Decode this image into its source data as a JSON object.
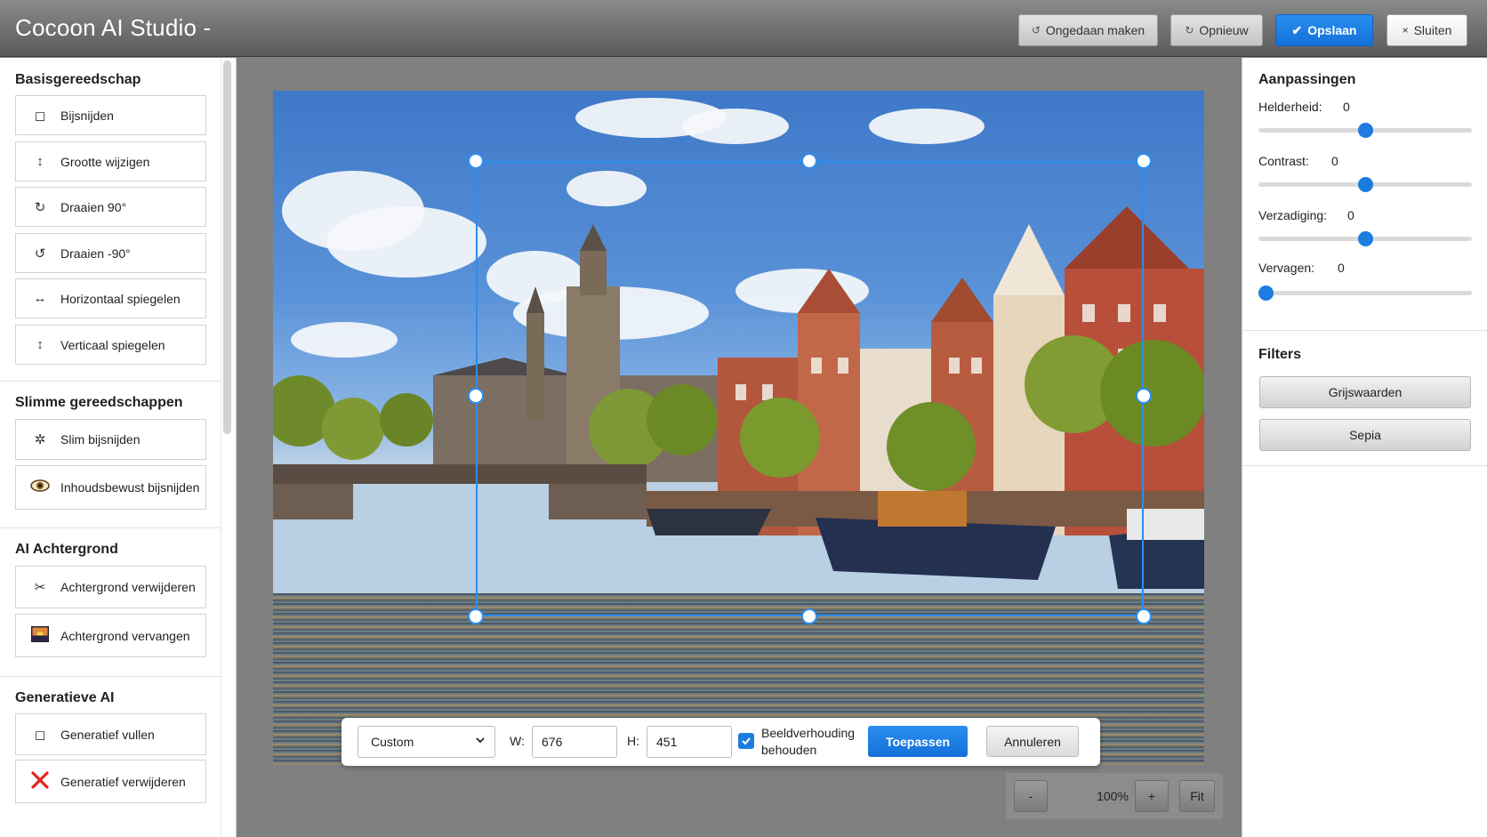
{
  "header": {
    "title": "Cocoon AI Studio -",
    "undo_label": "Ongedaan maken",
    "redo_label": "Opnieuw",
    "save_label": "Opslaan",
    "close_label": "Sluiten"
  },
  "sidebar": {
    "sections": [
      {
        "title": "Basisgereedschap",
        "items": [
          {
            "label": "Bijsnijden",
            "icon": "crop-icon"
          },
          {
            "label": "Grootte wijzigen",
            "icon": "resize-icon"
          },
          {
            "label": "Draaien 90°",
            "icon": "rotate-cw-icon"
          },
          {
            "label": "Draaien -90°",
            "icon": "rotate-ccw-icon"
          },
          {
            "label": "Horizontaal spiegelen",
            "icon": "flip-horizontal-icon"
          },
          {
            "label": "Verticaal spiegelen",
            "icon": "flip-vertical-icon"
          }
        ]
      },
      {
        "title": "Slimme gereedschappen",
        "items": [
          {
            "label": "Slim bijsnijden",
            "icon": "sparkle-icon"
          },
          {
            "label": "Inhoudsbewust bijsnijden",
            "icon": "eye-icon"
          }
        ]
      },
      {
        "title": "AI Achtergrond",
        "items": [
          {
            "label": "Achtergrond verwijderen",
            "icon": "scissors-icon"
          },
          {
            "label": "Achtergrond vervangen",
            "icon": "image-icon"
          }
        ]
      },
      {
        "title": "Generatieve AI",
        "items": [
          {
            "label": "Generatief vullen",
            "icon": "fill-icon"
          },
          {
            "label": "Generatief verwijderen",
            "icon": "delete-x-icon"
          }
        ]
      }
    ]
  },
  "crop_toolbar": {
    "ratio": "Custom",
    "width_label": "W:",
    "width_value": "676",
    "height_label": "H:",
    "height_value": "451",
    "keep_ratio_label": "Beeldverhouding behouden",
    "keep_ratio_checked": true,
    "apply_label": "Toepassen",
    "cancel_label": "Annuleren"
  },
  "zoom": {
    "minus_label": "-",
    "level": "100%",
    "plus_label": "+",
    "fit_label": "Fit"
  },
  "adjustments": {
    "title": "Aanpassingen",
    "items": [
      {
        "label": "Helderheid:",
        "value": "0",
        "position": 0.5
      },
      {
        "label": "Contrast:",
        "value": "0",
        "position": 0.5
      },
      {
        "label": "Verzadiging:",
        "value": "0",
        "position": 0.5
      },
      {
        "label": "Vervagen:",
        "value": "0",
        "position": 0.0
      }
    ]
  },
  "filters": {
    "title": "Filters",
    "items": [
      "Grijswaarden",
      "Sepia"
    ]
  },
  "colors": {
    "accent": "#1c7ce0",
    "header_bg": "#6e6e6e",
    "canvas_bg": "#808080"
  }
}
